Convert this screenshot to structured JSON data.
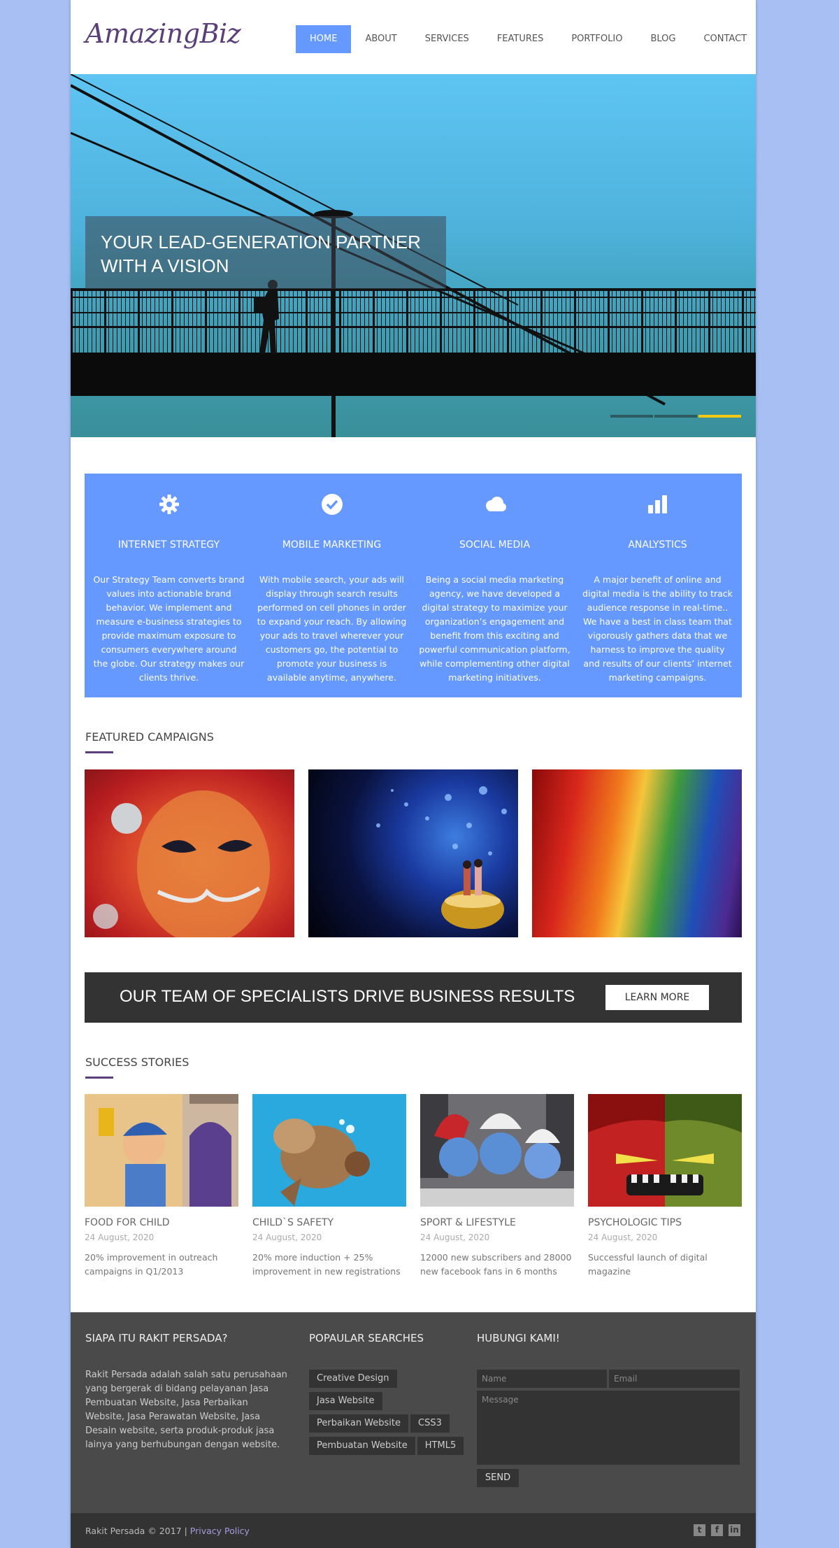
{
  "header": {
    "logo": "AmazingBiz",
    "nav": [
      "HOME",
      "ABOUT",
      "SERVICES",
      "FEATURES",
      "PORTFOLIO",
      "BLOG",
      "CONTACT"
    ]
  },
  "hero": {
    "caption": "YOUR LEAD-GENERATION PARTNER WITH A VISION",
    "slides": 3,
    "active_slide": 3
  },
  "services": [
    {
      "icon": "gear-icon",
      "title": "INTERNET STRATEGY",
      "text": "Our Strategy Team converts brand values into actionable brand behavior. We implement and measure e-business strategies to provide maximum exposure to consumers everywhere around the globe. Our strategy makes our clients thrive."
    },
    {
      "icon": "check-circle-icon",
      "title": "MOBILE MARKETING",
      "text": "With mobile search, your ads will display through search results performed on cell phones in order to expand your reach. By allowing your ads to travel wherever your customers go, the potential to promote your business is available anytime, anywhere."
    },
    {
      "icon": "cloud-icon",
      "title": "SOCIAL MEDIA",
      "text": "Being a social media marketing agency, we have developed a digital strategy to maximize your organization’s engagement and benefit from this exciting and powerful communication platform, while complementing other digital marketing initiatives."
    },
    {
      "icon": "bar-chart-icon",
      "title": "ANALYSTICS",
      "text": "A major benefit of online and digital media is the ability to track audience response in real-time.. We have a best in class team that vigorously gathers data that we harness to improve the quality and results of our clients’ internet marketing campaigns."
    }
  ],
  "featured": {
    "title": "FEATURED CAMPAIGNS"
  },
  "banner": {
    "text": "OUR TEAM OF SPECIALISTS DRIVE BUSINESS RESULTS",
    "button": "LEARN MORE"
  },
  "stories": {
    "title": "SUCCESS STORIES",
    "items": [
      {
        "title": "FOOD FOR CHILD",
        "date": "24 August, 2020",
        "text": "20% improvement in outreach campaigns in Q1/2013"
      },
      {
        "title": "CHILD`S SAFETY",
        "date": "24 August, 2020",
        "text": "20% more induction + 25% improvement in new registrations"
      },
      {
        "title": "SPORT & LIFESTYLE",
        "date": "24 August, 2020",
        "text": "12000 new subscribers and 28000 new facebook fans in 6 months"
      },
      {
        "title": "PSYCHOLOGIC TIPS",
        "date": "24 August, 2020",
        "text": "Successful launch of digital magazine"
      }
    ]
  },
  "footer": {
    "about_title": "SIAPA ITU RAKIT PERSADA?",
    "about_text": "Rakit Persada adalah salah satu perusahaan yang bergerak di bidang pelayanan Jasa Pembuatan Website, Jasa Perbaikan Website, Jasa Perawatan Website, Jasa Desain website, serta produk-produk jasa lainya yang berhubungan dengan website.",
    "searches_title": "POPAULAR SEARCHES",
    "tags": [
      "Creative Design",
      "Jasa Website",
      "Perbaikan Website",
      "CSS3",
      "Pembuatan Website",
      "HTML5"
    ],
    "contact_title": "HUBUNGI KAMI!",
    "name_placeholder": "Name",
    "email_placeholder": "Email",
    "message_placeholder": "Message",
    "send": "SEND",
    "copyright": "Rakit Persada © 2017 | ",
    "privacy": "Privacy Policy",
    "social": [
      "twitter-icon",
      "facebook-icon",
      "linkedin-icon"
    ]
  }
}
